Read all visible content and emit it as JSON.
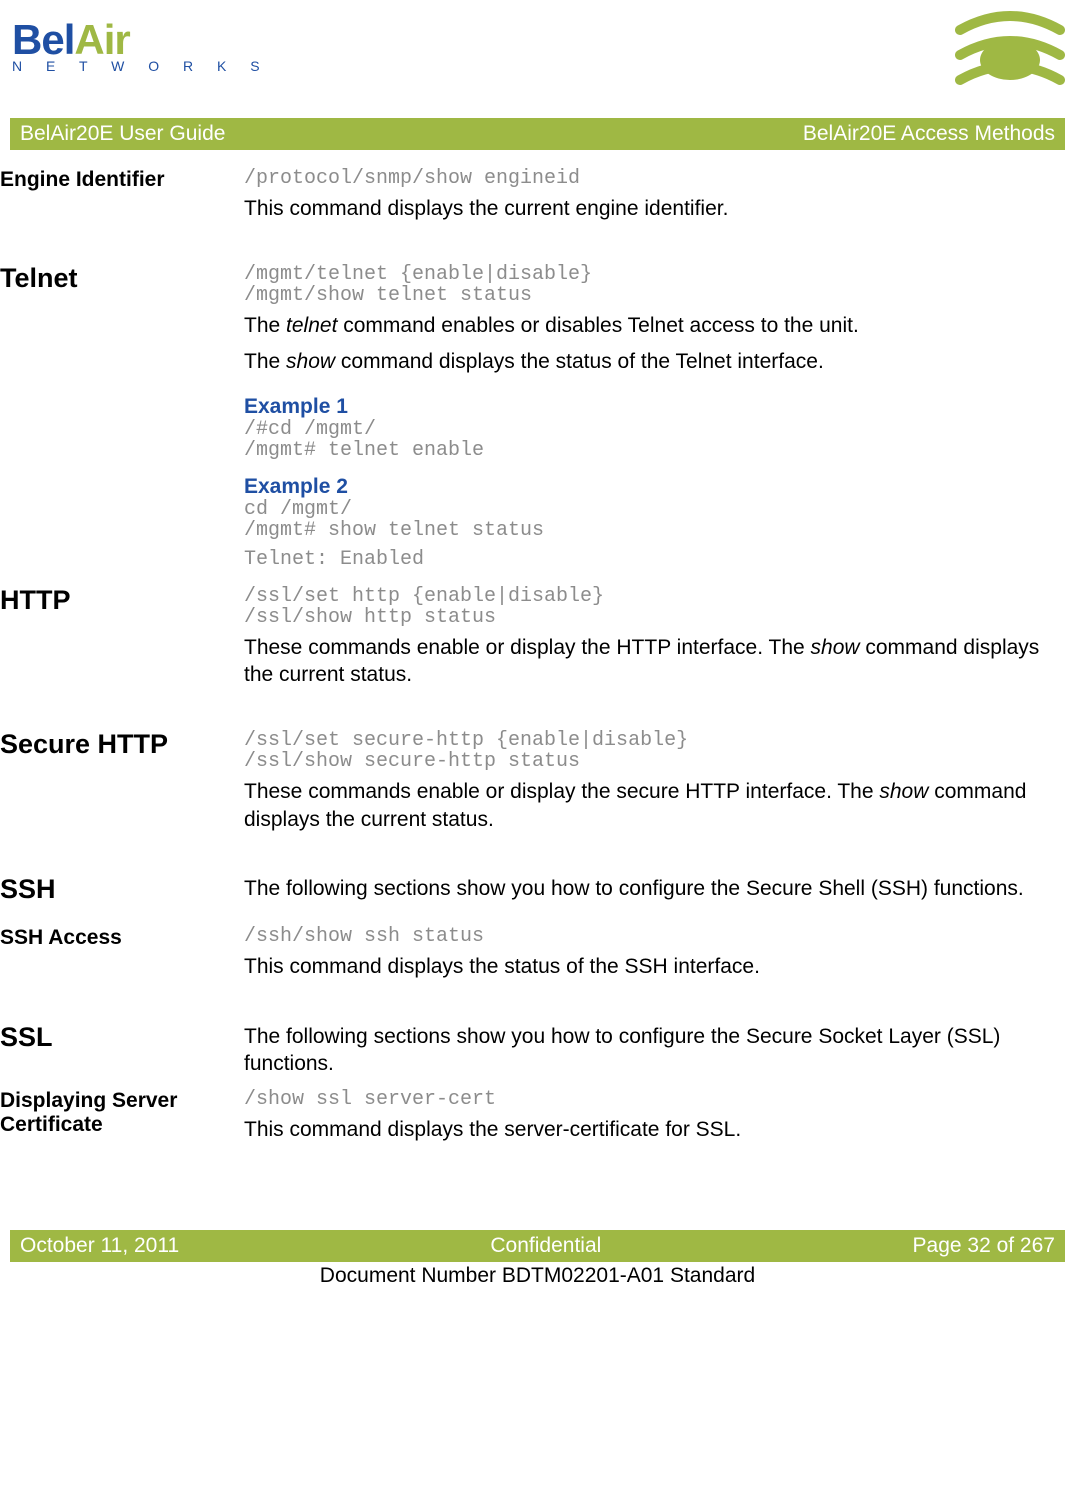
{
  "brand": {
    "name_a": "Bel",
    "name_b": "Air",
    "sub": "N E T W O R K S"
  },
  "header": {
    "left": "BelAir20E User Guide",
    "right": "BelAir20E Access Methods"
  },
  "sections": {
    "engine": {
      "title": "Engine Identifier",
      "cmd": "/protocol/snmp/show engineid",
      "desc": "This command displays the current engine identifier."
    },
    "telnet": {
      "title": "Telnet",
      "cmd": "/mgmt/telnet {enable|disable}\n/mgmt/show telnet status",
      "desc1a": "The ",
      "desc1b": "telnet",
      "desc1c": " command enables or disables Telnet access to the unit.",
      "desc2a": "The ",
      "desc2b": "show",
      "desc2c": " command displays the status of the Telnet interface.",
      "ex1_label": "Example 1",
      "ex1_code": "/#cd /mgmt/\n/mgmt# telnet enable",
      "ex2_label": "Example 2",
      "ex2_code": "cd /mgmt/\n/mgmt# show telnet status",
      "ex2_out": "Telnet: Enabled"
    },
    "http": {
      "title": "HTTP",
      "cmd": "/ssl/set http {enable|disable}\n/ssl/show http status",
      "desc_a": "These commands enable or display the HTTP interface. The ",
      "desc_b": "show",
      "desc_c": " command displays the current status."
    },
    "shttp": {
      "title": "Secure HTTP",
      "cmd": "/ssl/set secure-http {enable|disable}\n/ssl/show secure-http status",
      "desc_a": "These commands enable or display the secure HTTP interface. The ",
      "desc_b": "show",
      "desc_c": " command displays the current status."
    },
    "ssh": {
      "title": "SSH",
      "desc": "The following sections show you how to configure the Secure Shell (SSH) functions."
    },
    "sshaccess": {
      "title": "SSH Access",
      "cmd": "/ssh/show ssh status",
      "desc": "This command displays the status of the SSH interface."
    },
    "ssl": {
      "title": "SSL",
      "desc": "The following sections show you how to configure the Secure Socket Layer (SSL) functions."
    },
    "cert": {
      "title": "Displaying Server Certificate",
      "cmd": "/show ssl server-cert",
      "desc": "This command displays the server-certificate for SSL."
    }
  },
  "footer": {
    "left": "October 11, 2011",
    "center": "Confidential",
    "right": "Page 32 of 267"
  },
  "docnum": "Document Number BDTM02201-A01 Standard"
}
